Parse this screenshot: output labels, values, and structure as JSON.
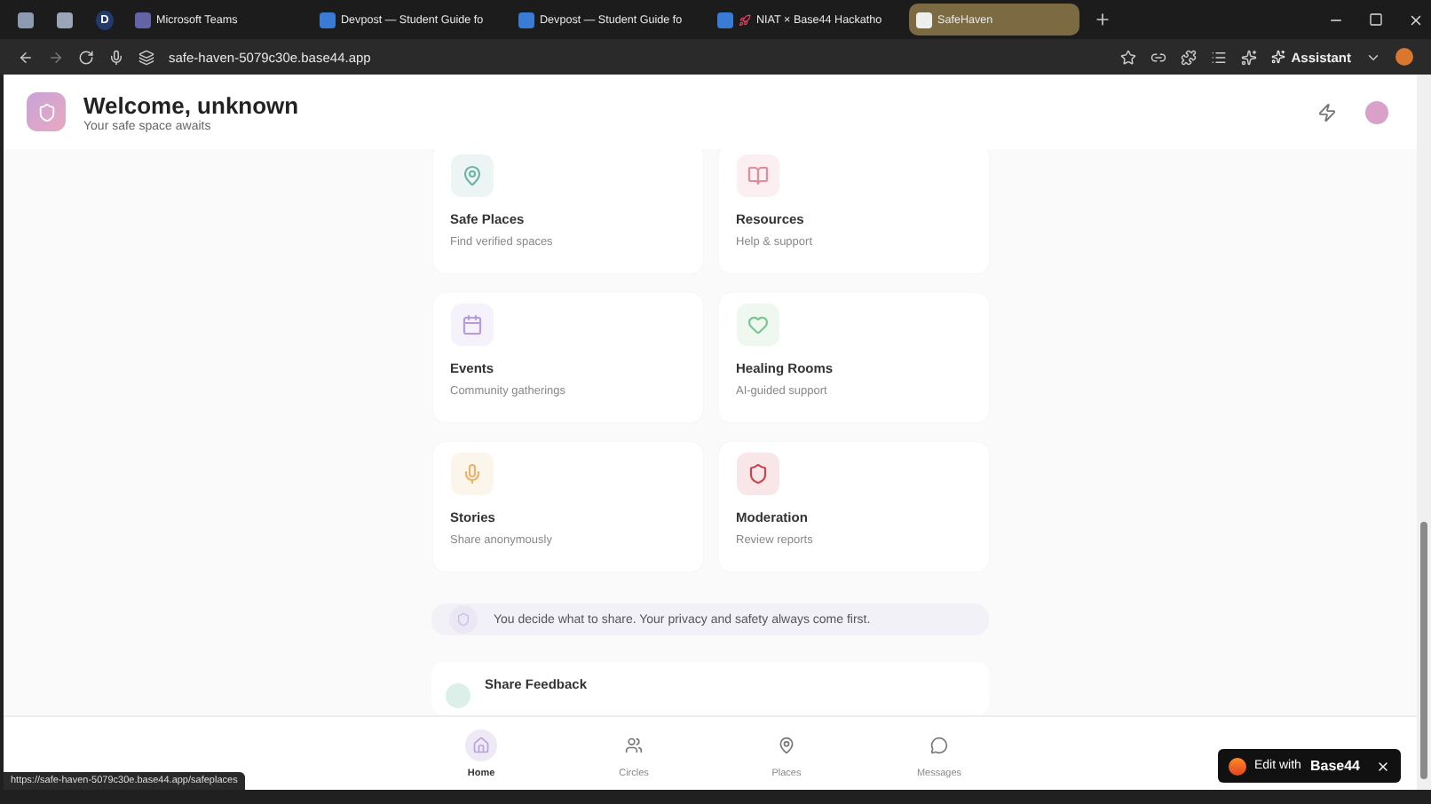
{
  "browser": {
    "tabs": [
      {
        "selected": false
      },
      {
        "selected": false
      },
      {
        "label": "D",
        "selected": false
      },
      {
        "label": "Microsoft Teams",
        "selected": false
      },
      {
        "label": "Devpost — Student Guide fo",
        "selected": false
      },
      {
        "label": "Devpost — Student Guide fo",
        "selected": false
      },
      {
        "label": "NIAT × Base44 Hackatho",
        "selected": false
      },
      {
        "label": "SafeHaven",
        "selected": true
      }
    ],
    "url": "safe-haven-5079c30e.base44.app",
    "assistant": "Assistant"
  },
  "header": {
    "title": "Welcome, unknown",
    "subtitle": "Your safe space awaits"
  },
  "cards": [
    {
      "title": "Safe Places",
      "subtitle": "Find verified spaces",
      "color": "#6fb3a6"
    },
    {
      "title": "Resources",
      "subtitle": "Help & support",
      "color": "#e58a9c"
    },
    {
      "title": "Events",
      "subtitle": "Community gatherings",
      "color": "#b79be0"
    },
    {
      "title": "Healing Rooms",
      "subtitle": "AI-guided support",
      "color": "#7cc58f"
    },
    {
      "title": "Stories",
      "subtitle": "Share anonymously",
      "color": "#e9b36a"
    },
    {
      "title": "Moderation",
      "subtitle": "Review reports",
      "color": "#c9444f"
    }
  ],
  "notice": "You decide what to share. Your privacy and safety always come first.",
  "feedback": {
    "title": "Share Feedback"
  },
  "nav": [
    {
      "label": "Home",
      "selected": true
    },
    {
      "label": "Circles",
      "selected": false
    },
    {
      "label": "Places",
      "selected": false
    },
    {
      "label": "Messages",
      "selected": false
    }
  ],
  "status_url": "https://safe-haven-5079c30e.base44.app/safeplaces",
  "edit_badge": {
    "prefix": "Edit with",
    "brand": "Base44"
  }
}
